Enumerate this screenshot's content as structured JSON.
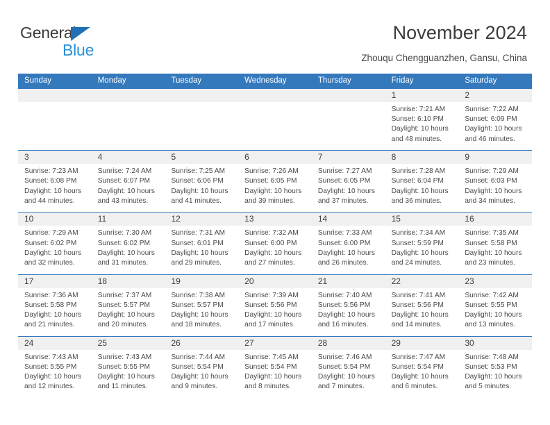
{
  "logo": {
    "word_one": "General",
    "word_two": "Blue",
    "triangle_color": "#1f6fb5",
    "blue_color": "#2a90d8"
  },
  "header": {
    "title": "November 2024",
    "subtitle": "Zhouqu Chengguanzhen, Gansu, China"
  },
  "theme": {
    "header_blue": "#3579bd",
    "daynum_band": "#f0f0f0",
    "text": "#4a4a4a"
  },
  "weekdays": [
    "Sunday",
    "Monday",
    "Tuesday",
    "Wednesday",
    "Thursday",
    "Friday",
    "Saturday"
  ],
  "weeks": [
    [
      {
        "empty": true
      },
      {
        "empty": true
      },
      {
        "empty": true
      },
      {
        "empty": true
      },
      {
        "empty": true
      },
      {
        "day": "1",
        "sunrise": "Sunrise: 7:21 AM",
        "sunset": "Sunset: 6:10 PM",
        "daylight": "Daylight: 10 hours and 48 minutes."
      },
      {
        "day": "2",
        "sunrise": "Sunrise: 7:22 AM",
        "sunset": "Sunset: 6:09 PM",
        "daylight": "Daylight: 10 hours and 46 minutes."
      }
    ],
    [
      {
        "day": "3",
        "sunrise": "Sunrise: 7:23 AM",
        "sunset": "Sunset: 6:08 PM",
        "daylight": "Daylight: 10 hours and 44 minutes."
      },
      {
        "day": "4",
        "sunrise": "Sunrise: 7:24 AM",
        "sunset": "Sunset: 6:07 PM",
        "daylight": "Daylight: 10 hours and 43 minutes."
      },
      {
        "day": "5",
        "sunrise": "Sunrise: 7:25 AM",
        "sunset": "Sunset: 6:06 PM",
        "daylight": "Daylight: 10 hours and 41 minutes."
      },
      {
        "day": "6",
        "sunrise": "Sunrise: 7:26 AM",
        "sunset": "Sunset: 6:05 PM",
        "daylight": "Daylight: 10 hours and 39 minutes."
      },
      {
        "day": "7",
        "sunrise": "Sunrise: 7:27 AM",
        "sunset": "Sunset: 6:05 PM",
        "daylight": "Daylight: 10 hours and 37 minutes."
      },
      {
        "day": "8",
        "sunrise": "Sunrise: 7:28 AM",
        "sunset": "Sunset: 6:04 PM",
        "daylight": "Daylight: 10 hours and 36 minutes."
      },
      {
        "day": "9",
        "sunrise": "Sunrise: 7:29 AM",
        "sunset": "Sunset: 6:03 PM",
        "daylight": "Daylight: 10 hours and 34 minutes."
      }
    ],
    [
      {
        "day": "10",
        "sunrise": "Sunrise: 7:29 AM",
        "sunset": "Sunset: 6:02 PM",
        "daylight": "Daylight: 10 hours and 32 minutes."
      },
      {
        "day": "11",
        "sunrise": "Sunrise: 7:30 AM",
        "sunset": "Sunset: 6:02 PM",
        "daylight": "Daylight: 10 hours and 31 minutes."
      },
      {
        "day": "12",
        "sunrise": "Sunrise: 7:31 AM",
        "sunset": "Sunset: 6:01 PM",
        "daylight": "Daylight: 10 hours and 29 minutes."
      },
      {
        "day": "13",
        "sunrise": "Sunrise: 7:32 AM",
        "sunset": "Sunset: 6:00 PM",
        "daylight": "Daylight: 10 hours and 27 minutes."
      },
      {
        "day": "14",
        "sunrise": "Sunrise: 7:33 AM",
        "sunset": "Sunset: 6:00 PM",
        "daylight": "Daylight: 10 hours and 26 minutes."
      },
      {
        "day": "15",
        "sunrise": "Sunrise: 7:34 AM",
        "sunset": "Sunset: 5:59 PM",
        "daylight": "Daylight: 10 hours and 24 minutes."
      },
      {
        "day": "16",
        "sunrise": "Sunrise: 7:35 AM",
        "sunset": "Sunset: 5:58 PM",
        "daylight": "Daylight: 10 hours and 23 minutes."
      }
    ],
    [
      {
        "day": "17",
        "sunrise": "Sunrise: 7:36 AM",
        "sunset": "Sunset: 5:58 PM",
        "daylight": "Daylight: 10 hours and 21 minutes."
      },
      {
        "day": "18",
        "sunrise": "Sunrise: 7:37 AM",
        "sunset": "Sunset: 5:57 PM",
        "daylight": "Daylight: 10 hours and 20 minutes."
      },
      {
        "day": "19",
        "sunrise": "Sunrise: 7:38 AM",
        "sunset": "Sunset: 5:57 PM",
        "daylight": "Daylight: 10 hours and 18 minutes."
      },
      {
        "day": "20",
        "sunrise": "Sunrise: 7:39 AM",
        "sunset": "Sunset: 5:56 PM",
        "daylight": "Daylight: 10 hours and 17 minutes."
      },
      {
        "day": "21",
        "sunrise": "Sunrise: 7:40 AM",
        "sunset": "Sunset: 5:56 PM",
        "daylight": "Daylight: 10 hours and 16 minutes."
      },
      {
        "day": "22",
        "sunrise": "Sunrise: 7:41 AM",
        "sunset": "Sunset: 5:56 PM",
        "daylight": "Daylight: 10 hours and 14 minutes."
      },
      {
        "day": "23",
        "sunrise": "Sunrise: 7:42 AM",
        "sunset": "Sunset: 5:55 PM",
        "daylight": "Daylight: 10 hours and 13 minutes."
      }
    ],
    [
      {
        "day": "24",
        "sunrise": "Sunrise: 7:43 AM",
        "sunset": "Sunset: 5:55 PM",
        "daylight": "Daylight: 10 hours and 12 minutes."
      },
      {
        "day": "25",
        "sunrise": "Sunrise: 7:43 AM",
        "sunset": "Sunset: 5:55 PM",
        "daylight": "Daylight: 10 hours and 11 minutes."
      },
      {
        "day": "26",
        "sunrise": "Sunrise: 7:44 AM",
        "sunset": "Sunset: 5:54 PM",
        "daylight": "Daylight: 10 hours and 9 minutes."
      },
      {
        "day": "27",
        "sunrise": "Sunrise: 7:45 AM",
        "sunset": "Sunset: 5:54 PM",
        "daylight": "Daylight: 10 hours and 8 minutes."
      },
      {
        "day": "28",
        "sunrise": "Sunrise: 7:46 AM",
        "sunset": "Sunset: 5:54 PM",
        "daylight": "Daylight: 10 hours and 7 minutes."
      },
      {
        "day": "29",
        "sunrise": "Sunrise: 7:47 AM",
        "sunset": "Sunset: 5:54 PM",
        "daylight": "Daylight: 10 hours and 6 minutes."
      },
      {
        "day": "30",
        "sunrise": "Sunrise: 7:48 AM",
        "sunset": "Sunset: 5:53 PM",
        "daylight": "Daylight: 10 hours and 5 minutes."
      }
    ]
  ]
}
